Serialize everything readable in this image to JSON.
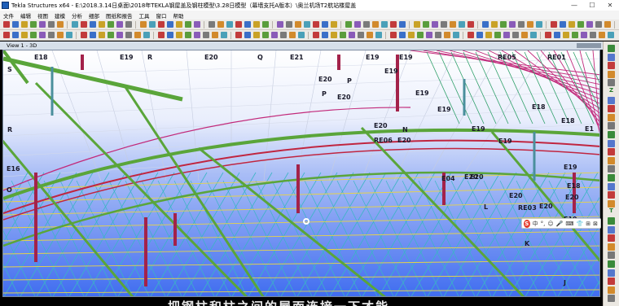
{
  "window": {
    "title": "Tekla Structures x64 - E:\\2018.3.14日桌面\\2018年TEKLA钢屋盖及钢柱模型\\3.28日模型（幕墙支托A版本）\\奥兰机场T2航站楼屋盖",
    "minimize": "—",
    "maximize": "☐",
    "close": "✕"
  },
  "menu": [
    "文件",
    "编辑",
    "视图",
    "建模",
    "分析",
    "细部",
    "图纸和报告",
    "工具",
    "窗口",
    "帮助"
  ],
  "view": {
    "title": "View 1 - 3D"
  },
  "grid_labels": [
    "E18",
    "E19",
    "R",
    "E20",
    "Q",
    "E21",
    "E19",
    "E19",
    "RE05",
    "RE01",
    "S",
    "E19",
    "E20",
    "P",
    "P",
    "E20",
    "E19",
    "E19",
    "E18",
    "R",
    "E20",
    "N",
    "E19",
    "E18",
    "E1",
    "RE06",
    "E20",
    "E19",
    "E16",
    "E20",
    "E19",
    "O",
    "E04",
    "E20",
    "E18",
    "E20",
    "RE03",
    "E20",
    "E20",
    "L",
    "E19",
    "E19",
    "K",
    "J"
  ],
  "ime": {
    "logo": "S",
    "text": [
      "中",
      "°,",
      "☺",
      "🎤",
      "⌨",
      "👕",
      "⊞",
      "⊠"
    ]
  },
  "subtitle": "把钢柱和柱之间的屋面连接一下才能",
  "rightbar_icons": [
    "Z",
    "T"
  ],
  "colors": {
    "sky_top": "#ffffff",
    "sky_bottom": "#3f6cf0",
    "green_member": "#5aa53a",
    "red_member": "#c02540",
    "magenta_member": "#c2297a",
    "cyan_member": "#3ab6c4",
    "yellow_member": "#e6d24a",
    "column": "#a3224a"
  }
}
